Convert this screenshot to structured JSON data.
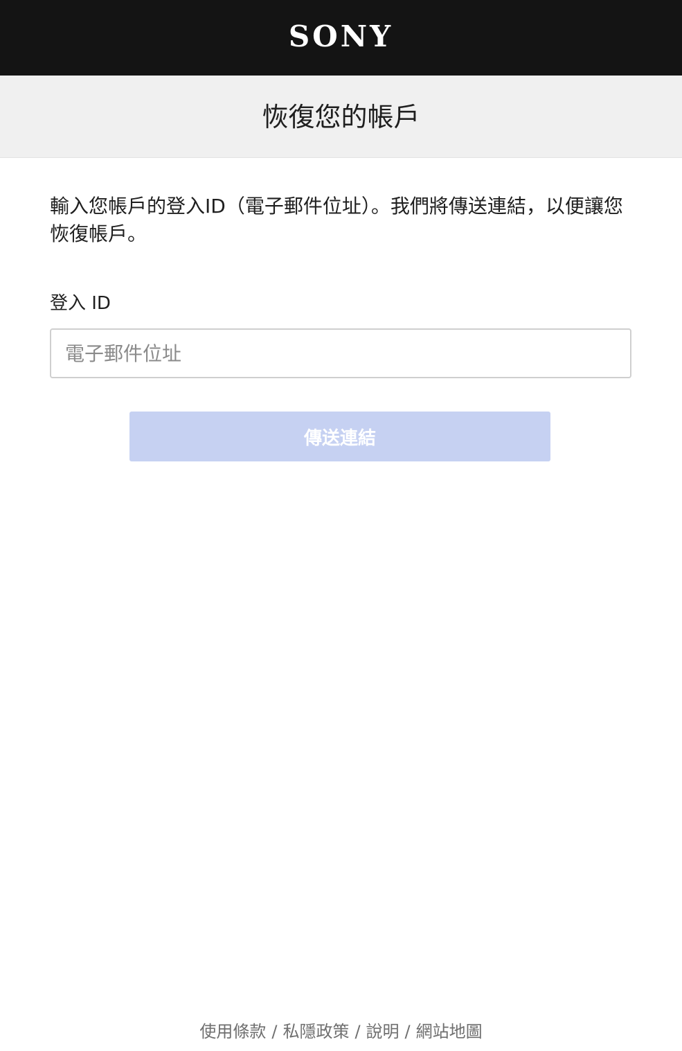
{
  "header": {
    "logo_text": "SONY",
    "background": "#141414"
  },
  "title_band": {
    "title": "恢復您的帳戶"
  },
  "main": {
    "description": "輸入您帳戶的登入ID（電子郵件位址）。我們將傳送連結，以便讓您恢復帳戶。",
    "login_label": "登入 ID",
    "email_input": {
      "value": "",
      "placeholder": "電子郵件位址"
    },
    "send_button_label": "傳送連結",
    "send_button_color": "#c6d1f2"
  },
  "footer": {
    "links": [
      "使用條款",
      "私隱政策",
      "說明",
      "網站地圖"
    ],
    "separator": "/"
  }
}
